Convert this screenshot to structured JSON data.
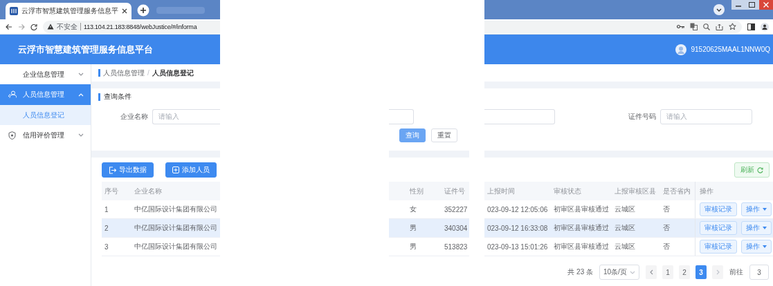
{
  "browser": {
    "tab_title": "云浮市智慧建筑管理服务信息平",
    "security_label": "不安全",
    "url": "113.104.21.183:8848/webJustice/#/informa"
  },
  "header": {
    "title": "云浮市智慧建筑管理服务信息平台",
    "user": "91520625MAAL1NNW0Q"
  },
  "sidebar": {
    "items": [
      {
        "label": "企业信息管理",
        "selected": false,
        "expanded": false
      },
      {
        "label": "人员信息管理",
        "selected": true,
        "expanded": true,
        "children": [
          {
            "label": "人员信息登记",
            "selected": true
          }
        ]
      },
      {
        "label": "信用评价管理",
        "selected": false,
        "expanded": false
      }
    ]
  },
  "breadcrumb": {
    "items": [
      "人员信息管理",
      "人员信息登记"
    ],
    "separator": "/"
  },
  "query": {
    "title": "查询条件",
    "fields": [
      {
        "label": "企业名称",
        "placeholder": "请输入"
      },
      {
        "label": "证件号码",
        "placeholder": "请输入"
      }
    ],
    "buttons": [
      {
        "label": "查询",
        "kind": "primary"
      },
      {
        "label": "重置",
        "kind": "default"
      }
    ]
  },
  "toolbar": {
    "buttons": [
      {
        "label": "导出数据",
        "kind": "export"
      },
      {
        "label": "添加人员",
        "kind": "add"
      }
    ],
    "refresh": "刷新"
  },
  "table": {
    "columns": [
      "序号",
      "企业名称",
      "性别",
      "证件号",
      "上报时间",
      "审核状态",
      "上报审核区县",
      "是否省内",
      "操作"
    ],
    "rows": [
      {
        "cells": [
          "1",
          "中亿国际设计集团有限公司",
          "女",
          "352227",
          "023-09-12 12:05:06",
          "初审区县审核通过",
          "云城区",
          "否"
        ],
        "actions": [
          {
            "label": "审核记录",
            "kind": "plain"
          },
          {
            "label": "操作",
            "kind": "dropdown"
          }
        ],
        "selected": false
      },
      {
        "cells": [
          "2",
          "中亿国际设计集团有限公司",
          "男",
          "340304",
          "023-09-12 16:33:08",
          "初审区县审核通过",
          "云城区",
          "否"
        ],
        "actions": [
          {
            "label": "审核记录",
            "kind": "plain"
          },
          {
            "label": "操作",
            "kind": "dropdown"
          }
        ],
        "selected": true
      },
      {
        "cells": [
          "3",
          "中亿国际设计集团有限公司",
          "男",
          "513823",
          "023-09-13 15:01:26",
          "初审区县审核通过",
          "云城区",
          "否"
        ],
        "actions": [
          {
            "label": "审核记录",
            "kind": "plain"
          },
          {
            "label": "操作",
            "kind": "dropdown"
          }
        ],
        "selected": false
      }
    ]
  },
  "pagination": {
    "total": "共 23 条",
    "page_size": "10条/页",
    "pages": [
      {
        "label": "1",
        "selected": false
      },
      {
        "label": "2",
        "selected": false
      },
      {
        "label": "3",
        "selected": true
      }
    ],
    "goto_label": "前往",
    "goto_value": "3"
  }
}
